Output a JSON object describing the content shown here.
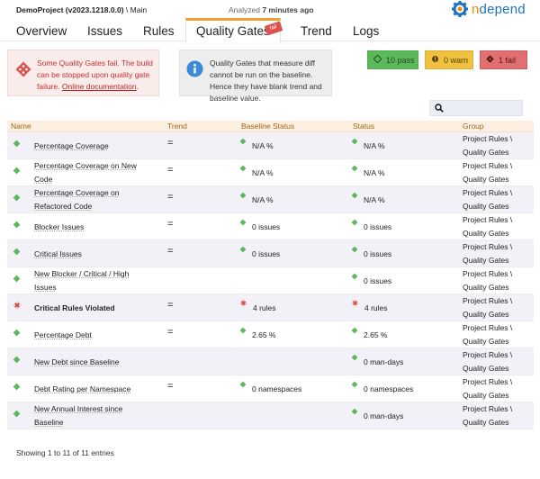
{
  "header": {
    "project_name": "DemoProject (v2023.1218.0.0)",
    "project_branch": " \\ Main",
    "analyzed_prefix": "Analyzed ",
    "analyzed_time": "7 minutes ago",
    "logo_n": "n",
    "logo_rest": "depend"
  },
  "tabs": [
    {
      "label": "Overview"
    },
    {
      "label": "Issues"
    },
    {
      "label": "Rules"
    },
    {
      "label": "Quality Gates",
      "active": true,
      "badge": "fail"
    },
    {
      "label": "Trend"
    },
    {
      "label": "Logs"
    }
  ],
  "alerts": {
    "fail_text": "Some Quality Gates fail. The build can be stopped upon quality gate failure. ",
    "fail_link": "Online documentation",
    "fail_end": ".",
    "info_text": "Quality Gates that measure diff cannot be run on the baseline. Hence they have blank trend and baseline value."
  },
  "badges": {
    "pass": "10 pass",
    "warn": "0 warn",
    "fail": "1 fail"
  },
  "search": {
    "placeholder": "",
    "value": ""
  },
  "table": {
    "columns": [
      "Name",
      "Trend",
      "Baseline Status",
      "Status",
      "Group"
    ],
    "rows": [
      {
        "status": "pass",
        "name": "Percentage Coverage",
        "trend": "=",
        "baseline": "N/A %",
        "value": "N/A %",
        "group": "Project Rules \\ Quality Gates"
      },
      {
        "status": "pass",
        "name": "Percentage Coverage on New Code",
        "trend": "=",
        "baseline": "N/A %",
        "value": "N/A %",
        "group": "Project Rules \\ Quality Gates"
      },
      {
        "status": "pass",
        "name": "Percentage Coverage on Refactored Code",
        "trend": "=",
        "baseline": "N/A %",
        "value": "N/A %",
        "group": "Project Rules \\ Quality Gates"
      },
      {
        "status": "pass",
        "name": "Blocker Issues",
        "trend": "=",
        "baseline": "0 issues",
        "value": "0 issues",
        "group": "Project Rules \\ Quality Gates"
      },
      {
        "status": "pass",
        "name": "Critical Issues",
        "trend": "=",
        "baseline": "0 issues",
        "value": "0 issues",
        "group": "Project Rules \\ Quality Gates"
      },
      {
        "status": "pass",
        "name": "New Blocker / Critical / High Issues",
        "trend": "",
        "baseline": "",
        "value": "0 issues",
        "group": "Project Rules \\ Quality Gates"
      },
      {
        "status": "fail",
        "name": "Critical Rules Violated",
        "trend": "=",
        "baseline": "4 rules",
        "value": "4 rules",
        "group": "Project Rules \\ Quality Gates"
      },
      {
        "status": "pass",
        "name": "Percentage Debt",
        "trend": "=",
        "baseline": "2.65 %",
        "value": "2.65 %",
        "group": "Project Rules \\ Quality Gates"
      },
      {
        "status": "pass",
        "name": "New Debt since Baseline",
        "trend": "",
        "baseline": "",
        "value": "0 man-days",
        "group": "Project Rules \\ Quality Gates"
      },
      {
        "status": "pass",
        "name": "Debt Rating per Namespace",
        "trend": "=",
        "baseline": "0 namespaces",
        "value": "0 namespaces",
        "group": "Project Rules \\ Quality Gates"
      },
      {
        "status": "pass",
        "name": "New Annual Interest since Baseline",
        "trend": "",
        "baseline": "",
        "value": "0 man-days",
        "group": "Project Rules \\ Quality Gates"
      }
    ]
  },
  "footer": {
    "entries": "Showing 1 to 11 of 11 entries"
  },
  "colors": {
    "pass": "#5cb85c",
    "fail": "#d9534f",
    "warn": "#f0c040",
    "accent": "#f0a030",
    "header_text": "#a0631e"
  }
}
